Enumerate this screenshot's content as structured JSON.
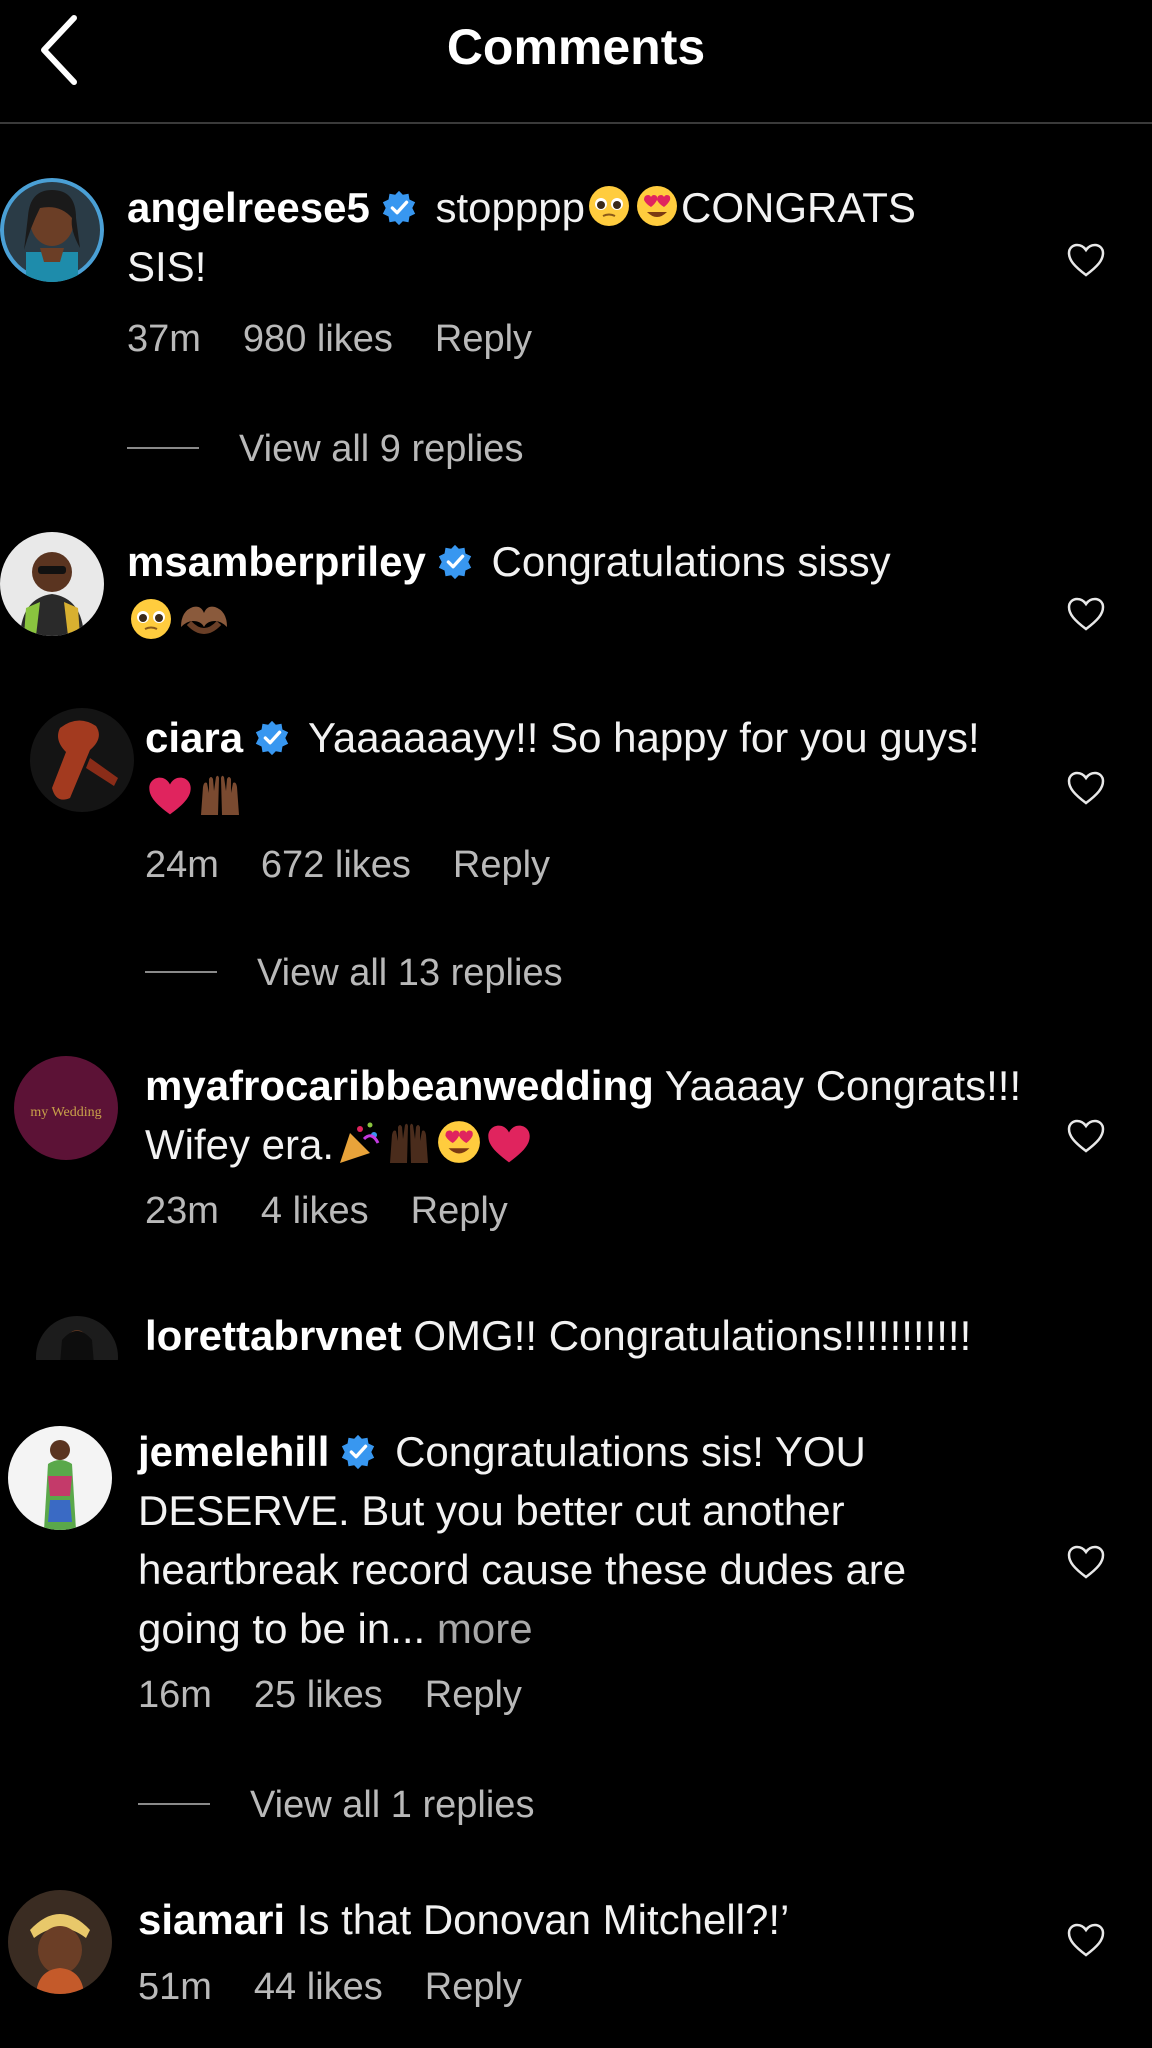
{
  "header": {
    "title": "Comments"
  },
  "colors": {
    "background": "#000000",
    "verified_badge": "#3897f0",
    "heart_red": "#e0245e"
  },
  "comments": [
    {
      "username": "angelreese5",
      "verified": true,
      "text_before_emoji": "stopppp",
      "emojis": [
        "pleading-face",
        "heart-eyes"
      ],
      "text_after_emoji": "CONGRATS SIS!",
      "time": "37m",
      "likes": "980 likes",
      "reply": "Reply",
      "view_replies": "View all 9 replies"
    },
    {
      "username": "msamberpriley",
      "verified": true,
      "text": "Congratulations sissy",
      "emojis": [
        "pleading-face",
        "heart-hands"
      ]
    },
    {
      "username": "ciara",
      "verified": true,
      "text": "Yaaaaaayy!! So happy for you guys!",
      "emojis": [
        "red-heart",
        "raising-hands"
      ],
      "time": "24m",
      "likes": "672 likes",
      "reply": "Reply",
      "view_replies": "View all 13 replies"
    },
    {
      "username": "myafrocaribbeanwedding",
      "verified": false,
      "text": "Yaaaay Congrats!!! Wifey era.",
      "emojis": [
        "party-popper",
        "raising-hands",
        "heart-eyes",
        "red-heart"
      ],
      "avatar_text": "my Wedding",
      "time": "23m",
      "likes": "4 likes",
      "reply": "Reply"
    },
    {
      "username": "lorettabrvnet",
      "verified": false,
      "text": "OMG!! Congratulations!!!!!!!!!!!"
    },
    {
      "username": "jemelehill",
      "verified": true,
      "text": "Congratulations sis! YOU DESERVE. But you better cut another heartbreak record cause these dudes are going to be in...",
      "more": "more",
      "time": "16m",
      "likes": "25 likes",
      "reply": "Reply",
      "view_replies": "View all 1 replies"
    },
    {
      "username": "siamari",
      "verified": false,
      "text": "Is that Donovan Mitchell?!’",
      "time": "51m",
      "likes": "44 likes",
      "reply": "Reply"
    }
  ]
}
